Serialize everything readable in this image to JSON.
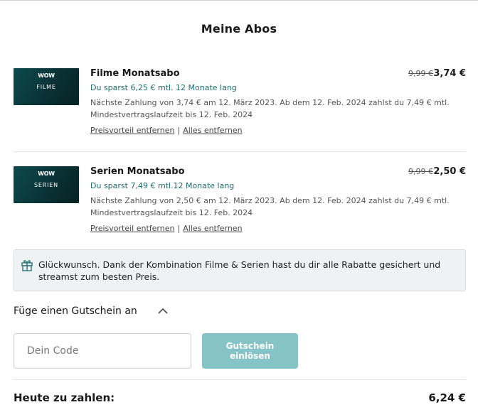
{
  "header": {
    "title": "Meine Abos"
  },
  "subscriptions": [
    {
      "thumb_logo": "WOW",
      "thumb_label": "FILME",
      "name": "Filme Monatsabo",
      "old_price": "9,99 €",
      "new_price": "3,74 €",
      "saving": "Du sparst 6,25 € mtl. 12 Monate lang",
      "detail_line1": "Nächste Zahlung von 3,74 € am 12. März 2023. Ab dem 12. Feb. 2024 zahlst du 7,49 € mtl.",
      "detail_line2": "Mindestvertragslaufzeit bis 12. Feb. 2024",
      "link_remove_discount": "Preisvorteil entfernen",
      "link_separator": "|",
      "link_remove_all": "Alles entfernen"
    },
    {
      "thumb_logo": "WOW",
      "thumb_label": "SERIEN",
      "name": "Serien Monatsabo",
      "old_price": "9,99 €",
      "new_price": "2,50 €",
      "saving": "Du sparst 7,49 € mtl.12 Monate lang",
      "detail_line1": "Nächste Zahlung von 2,50 € am 12. März 2023. Ab dem 12. Feb. 2024 zahlst du 7,49 € mtl.",
      "detail_line2": "Mindestvertragslaufzeit bis 12. Feb. 2024",
      "link_remove_discount": "Preisvorteil entfernen",
      "link_separator": "|",
      "link_remove_all": "Alles entfernen"
    }
  ],
  "notice": {
    "icon": "gift-icon",
    "text": "Glückwunsch. Dank der Kombination Filme & Serien hast du dir alle Rabatte gesichert und streamst zum besten Preis."
  },
  "voucher": {
    "label": "Füge einen Gutschein an",
    "placeholder": "Dein Code",
    "button_label": "Gutschein einlösen"
  },
  "total": {
    "label": "Heute zu zahlen:",
    "value": "6,24 €"
  },
  "colors": {
    "accent": "#1c6b6e",
    "button": "#85c3c6",
    "thumb": "#0a3235"
  }
}
